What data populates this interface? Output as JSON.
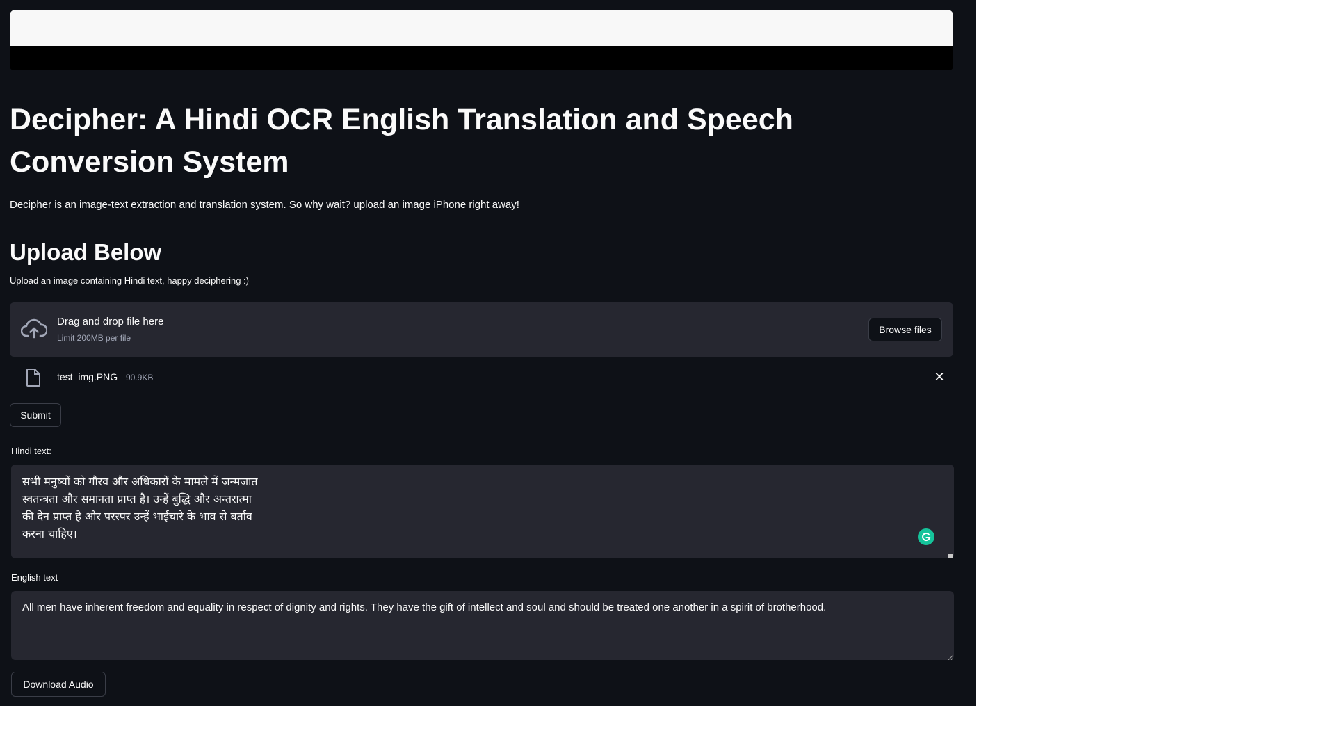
{
  "page": {
    "title": "Decipher: A Hindi OCR English Translation and Speech Conversion System",
    "intro": "Decipher is an image-text extraction and translation system. So why wait? upload an image iPhone right away!",
    "section_heading": "Upload Below"
  },
  "uploader": {
    "label": "Upload an image containing Hindi text, happy deciphering :)",
    "drop_text": "Drag and drop file here",
    "limit_text": "Limit 200MB per file",
    "browse_label": "Browse files",
    "upload_icon": "cloud-upload-icon",
    "file": {
      "name": "test_img.PNG",
      "size": "90.9KB",
      "icon": "file-icon",
      "remove_icon": "close-icon"
    }
  },
  "submit_label": "Submit",
  "hindi": {
    "label": "Hindi text:",
    "value": "सभी मनुष्यों को गौरव और अधिकारों के मामले में जन्मजात\nस्वतन्त्रता और समानता प्राप्त है। उन्हें बुद्धि और अन्तरात्मा\nकी देन प्राप्त है और परस्पर उन्हें भाईचारे के भाव से बर्ताव\nकरना चाहिए।"
  },
  "english": {
    "label": "English text",
    "value": "All men have inherent freedom and equality in respect of dignity and rights. They have the gift of intellect and soul and should be treated one another in a spirit of brotherhood."
  },
  "download_label": "Download Audio",
  "colors": {
    "app_background": "#0e1117",
    "input_background": "#262730",
    "text": "#fafafa",
    "muted_text": "#a3a8b8",
    "grammarly_green": "#15c39a"
  }
}
